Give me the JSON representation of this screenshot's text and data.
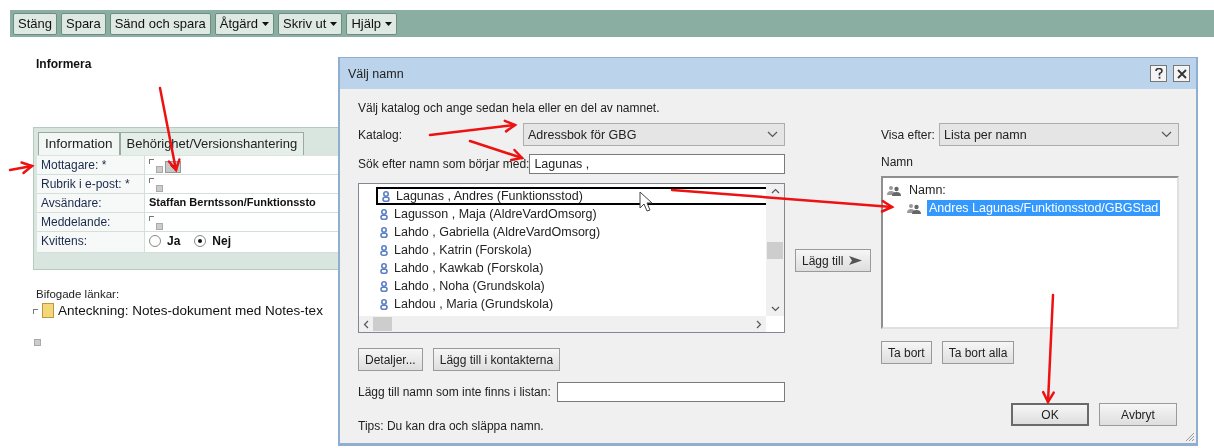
{
  "toolbar": {
    "buttons": [
      {
        "label": "Stäng",
        "menu": false
      },
      {
        "label": "Spara",
        "menu": false
      },
      {
        "label": "Sänd och spara",
        "menu": false
      },
      {
        "label": "Åtgärd",
        "menu": true
      },
      {
        "label": "Skriv ut",
        "menu": true
      },
      {
        "label": "Hjälp",
        "menu": true
      }
    ]
  },
  "form": {
    "title": "Informera",
    "tabs": [
      {
        "label": "Information",
        "selected": true
      },
      {
        "label": "Behörighet/Versionshantering",
        "selected": false
      }
    ],
    "fields": [
      {
        "label": "Mottagare: *",
        "kind": "picker"
      },
      {
        "label": "Rubrik i e-post: *",
        "kind": "empty"
      },
      {
        "label": "Avsändare:",
        "kind": "text",
        "value": "Staffan Berntsson/Funktionssto"
      },
      {
        "label": "Meddelande:",
        "kind": "empty"
      },
      {
        "label": "Kvittens:",
        "kind": "radio",
        "options": [
          {
            "label": "Ja",
            "selected": false
          },
          {
            "label": "Nej",
            "selected": true
          }
        ]
      }
    ],
    "attachments_label": "Bifogade länkar:",
    "attachment": "Anteckning: Notes-dokument med Notes-tex"
  },
  "dialog": {
    "title": "Välj namn",
    "instruction": "Välj katalog och ange sedan hela eller en del av namnet.",
    "catalog_label": "Katalog:",
    "catalog": "Adressbok för GBG",
    "search_label": "Sök efter namn som börjar med:",
    "search_value": "Lagunas ,",
    "names": [
      {
        "label": "Lagunas , Andres (Funktionsstod)",
        "focused": true
      },
      {
        "label": "Lagusson , Maja (AldreVardOmsorg)",
        "focused": false
      },
      {
        "label": "Lahdo , Gabriella (AldreVardOmsorg)",
        "focused": false
      },
      {
        "label": "Lahdo , Katrin (Forskola)",
        "focused": false
      },
      {
        "label": "Lahdo , Kawkab (Forskola)",
        "focused": false
      },
      {
        "label": "Lahdo , Noha (Grundskola)",
        "focused": false
      },
      {
        "label": "Lahdou , Maria (Grundskola)",
        "focused": false
      }
    ],
    "left_buttons": [
      "Detaljer...",
      "Lägg till i kontakterna"
    ],
    "add_button": "Lägg till",
    "add_name_label": "Lägg till namn som inte finns i listan:",
    "tip": "Tips: Du kan dra och släppa namn.",
    "view_label": "Visa efter:",
    "view": "Lista per namn",
    "selected_label": "Namn",
    "selected_tree": [
      {
        "label": "Namn:",
        "selected": false,
        "children": [
          {
            "label": "Andres Lagunas/Funktionsstod/GBGStad",
            "selected": true
          }
        ]
      }
    ],
    "right_buttons": [
      "Ta bort",
      "Ta bort alla"
    ],
    "ok": "OK",
    "cancel": "Avbryt"
  }
}
